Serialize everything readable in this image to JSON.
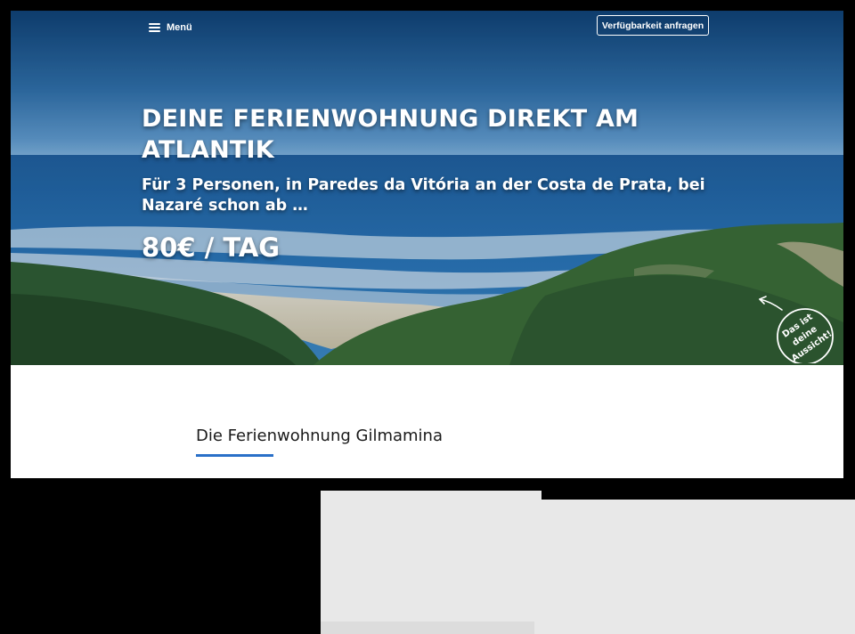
{
  "header": {
    "menu_label": "Menü",
    "cta_label": "Verfügbarkeit anfragen",
    "menu_icon": "hamburger-icon"
  },
  "hero": {
    "title": "DEINE FERIENWOHNUNG DIREKT AM ATLANTIK",
    "subtitle": "Für 3 Personen, in Paredes da Vitória an der Costa de Prata, bei Nazaré schon ab …",
    "price": "80€ / TAG",
    "badge": {
      "line1": "Das ist",
      "line2": "deine",
      "line3": "Aussicht!",
      "icon": "curved-arrow-icon"
    }
  },
  "content": {
    "section_title": "Die Ferienwohnung Gilmamina"
  },
  "colors": {
    "accent": "#2a70c8",
    "page_background": "#000000",
    "placeholder": "#e8e8e8"
  }
}
